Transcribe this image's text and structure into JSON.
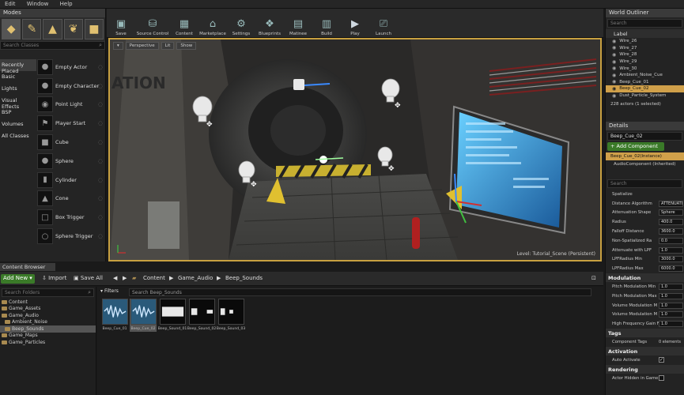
{
  "menu": [
    "Edit",
    "Window",
    "Help"
  ],
  "modes": {
    "tab": "Modes",
    "search_placeholder": "Search Classes",
    "categories": [
      "Recently Placed",
      "Basic",
      "Lights",
      "Visual Effects",
      "BSP",
      "Volumes",
      "All Classes"
    ],
    "items": [
      "Empty Actor",
      "Empty Character",
      "Point Light",
      "Player Start",
      "Cube",
      "Sphere",
      "Cylinder",
      "Cone",
      "Box Trigger",
      "Sphere Trigger"
    ]
  },
  "toolbar": [
    "Save",
    "Source Control",
    "Content",
    "Marketplace",
    "Settings",
    "Blueprints",
    "Matinee",
    "Build",
    "Play",
    "Launch"
  ],
  "viewport": {
    "perspective": "Perspective",
    "lit": "Lit",
    "show": "Show",
    "level_label": "Level:",
    "level_name": "Tutorial_Scene (Persistent)"
  },
  "outliner": {
    "tab": "World Outliner",
    "search_placeholder": "Search",
    "column": "Label",
    "items": [
      "Wire_26",
      "Wire_27",
      "Wire_28",
      "Wire_29",
      "Wire_30",
      "Ambient_Noise_Cue",
      "Beep_Cue_01",
      "Beep_Cue_02",
      "Dust_Particle_System"
    ],
    "selected_index": 7,
    "status": "228 actors (1 selected)"
  },
  "details": {
    "tab": "Details",
    "name_value": "Beep_Cue_02",
    "add_component": "+ Add Component",
    "instance": "Beep_Cue_02(Instance)",
    "component": "AudioComponent (Inherited)",
    "search_placeholder": "Search",
    "attenuation_rows": [
      {
        "label": "Spatialize",
        "value": ""
      },
      {
        "label": "Distance Algorithm",
        "value": "ATTENUATION"
      },
      {
        "label": "Attenuation Shape",
        "value": "Sphere"
      },
      {
        "label": "Radius",
        "value": "400.0"
      },
      {
        "label": "Falloff Distance",
        "value": "3600.0"
      },
      {
        "label": "Non-Spatialized Ra",
        "value": "0.0"
      },
      {
        "label": "Attenuate with LPF",
        "value": "1.0"
      },
      {
        "label": "LPFRadius Min",
        "value": "3000.0"
      },
      {
        "label": "LPFRadius Max",
        "value": "6000.0"
      }
    ],
    "modulation_title": "Modulation",
    "modulation_rows": [
      {
        "label": "Pitch Modulation Min",
        "value": "1.0"
      },
      {
        "label": "Pitch Modulation Max",
        "value": "1.0"
      },
      {
        "label": "Volume Modulation M",
        "value": "1.0"
      },
      {
        "label": "Volume Modulation M",
        "value": "1.0"
      },
      {
        "label": "High Frequency Gain F",
        "value": "1.0"
      }
    ],
    "tags_title": "Tags",
    "component_tags": "Component Tags",
    "component_tags_value": "0 elements",
    "activation_title": "Activation",
    "auto_activate": "Auto Activate",
    "rendering_title": "Rendering",
    "actor_hidden": "Actor Hidden in Game"
  },
  "content_browser": {
    "tab": "Content Browser",
    "add_new": "Add New",
    "import": "Import",
    "save_all": "Save All",
    "path": [
      "Content",
      "Game_Audio",
      "Beep_Sounds"
    ],
    "filters": "Filters",
    "search_value": "Search Beep_Sounds",
    "folder_search_placeholder": "Search Folders",
    "tree": [
      {
        "label": "Content",
        "depth": 0
      },
      {
        "label": "Game_Assets",
        "depth": 1
      },
      {
        "label": "Game_Audio",
        "depth": 1
      },
      {
        "label": "Ambient_Noise",
        "depth": 2
      },
      {
        "label": "Beep_Sounds",
        "depth": 2,
        "selected": true
      },
      {
        "label": "Game_Maps",
        "depth": 1
      },
      {
        "label": "Game_Particles",
        "depth": 1
      }
    ],
    "assets": [
      "Beep_Cue_01",
      "Beep_Cue_02",
      "Beep_Sound_01",
      "Beep_Sound_02",
      "Beep_Sound_03"
    ]
  },
  "colors": {
    "selection": "#d0a04a",
    "add_green": "#3a7a28",
    "viewport_border": "#c8a040"
  }
}
